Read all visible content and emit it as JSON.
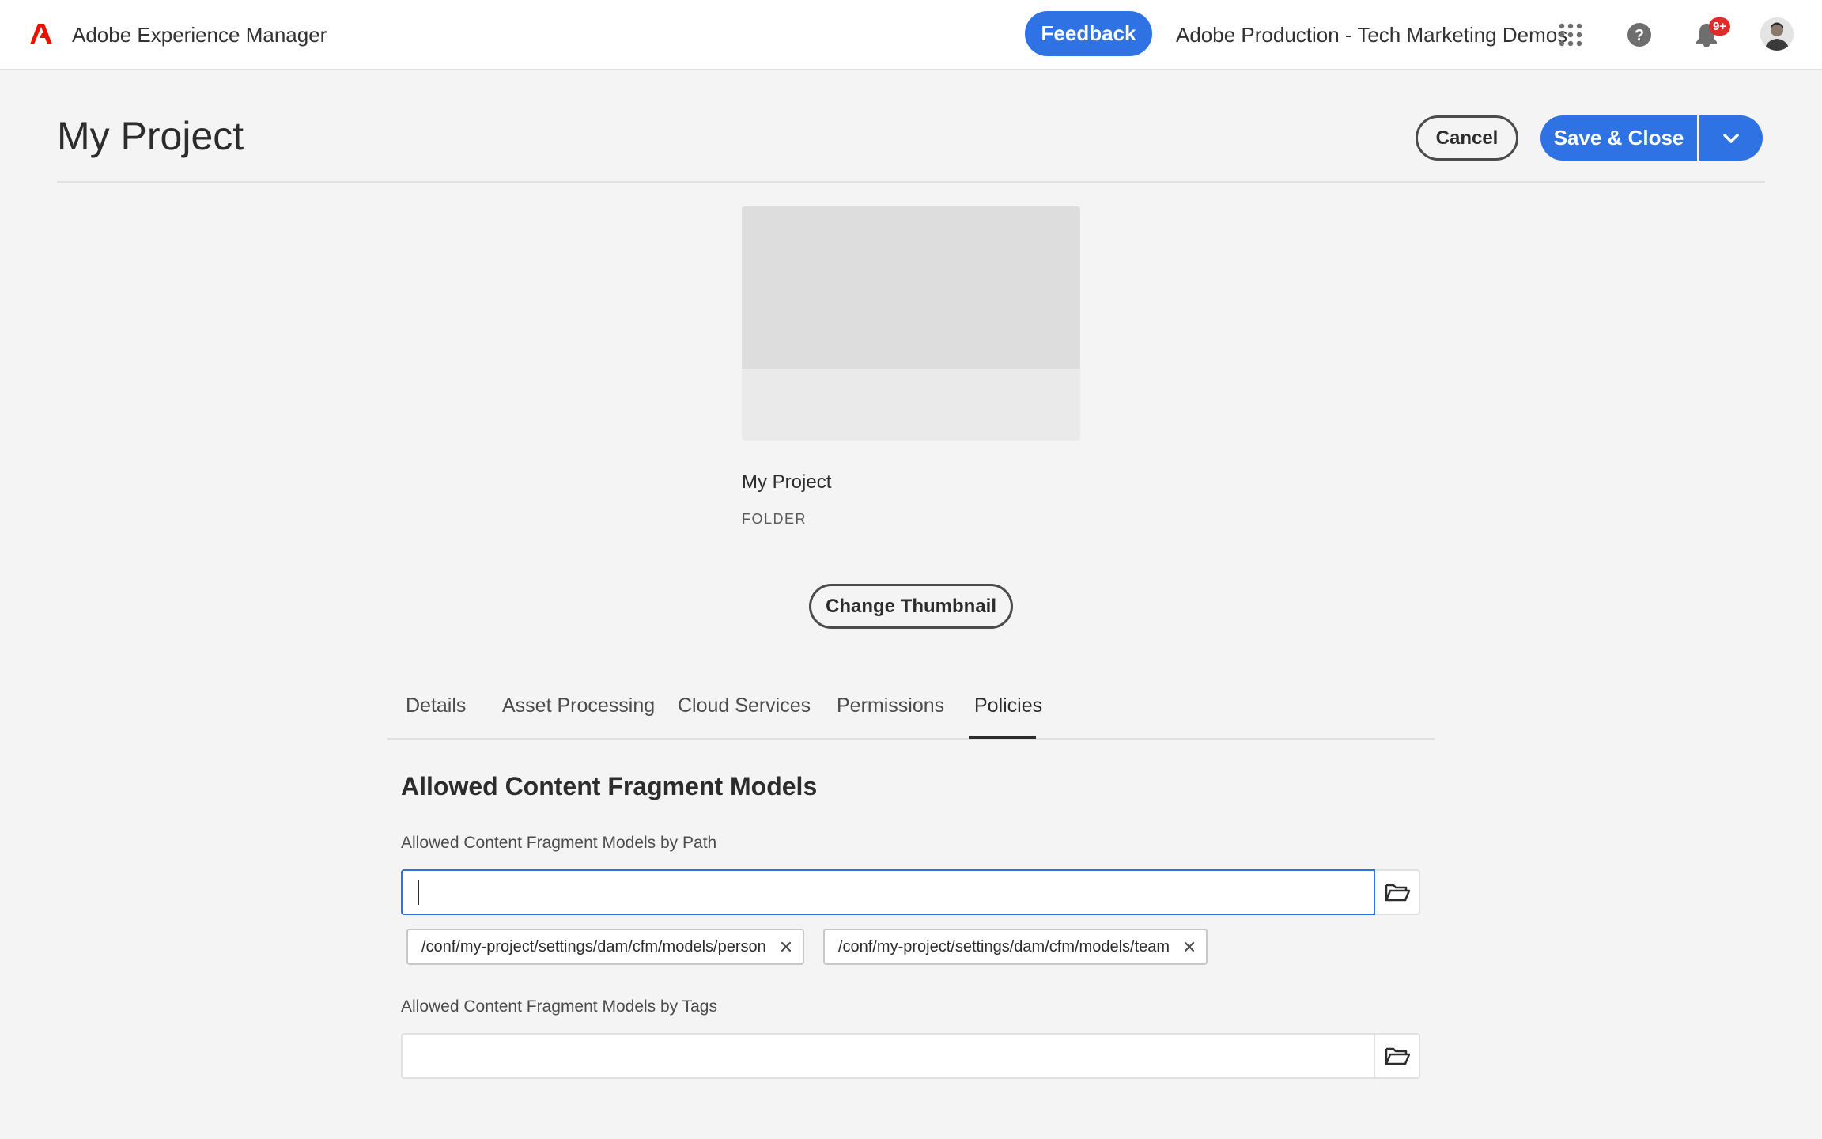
{
  "shell": {
    "app_title": "Adobe Experience Manager",
    "feedback_label": "Feedback",
    "org_name": "Adobe Production - Tech Marketing Demos",
    "notification_count": "9+",
    "icons": [
      "adobe-logo-icon",
      "apps-grid-icon",
      "help-icon",
      "bell-icon",
      "avatar"
    ]
  },
  "header": {
    "title": "My Project",
    "cancel_label": "Cancel",
    "save_label": "Save & Close"
  },
  "card": {
    "name": "My Project",
    "type": "FOLDER",
    "change_thumbnail_label": "Change Thumbnail"
  },
  "tabs": [
    {
      "label": "Details"
    },
    {
      "label": "Asset Processing"
    },
    {
      "label": "Cloud Services"
    },
    {
      "label": "Permissions"
    },
    {
      "label": "Policies",
      "active": true
    }
  ],
  "policies": {
    "heading": "Allowed Content Fragment Models",
    "by_path_label": "Allowed Content Fragment Models by Path",
    "by_path_value": "",
    "by_path_chips": [
      "/conf/my-project/settings/dam/cfm/models/person",
      "/conf/my-project/settings/dam/cfm/models/team"
    ],
    "by_tags_label": "Allowed Content Fragment Models by Tags",
    "by_tags_value": ""
  },
  "colors": {
    "accent": "#2f72e4",
    "adobe_red": "#eb1000",
    "badge": "#e02b2b",
    "background": "#f4f4f4"
  }
}
